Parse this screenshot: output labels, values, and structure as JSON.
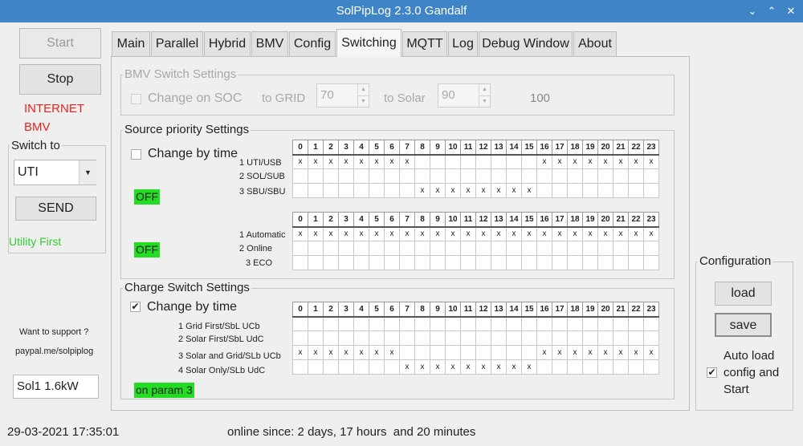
{
  "window": {
    "title": "SolPipLog 2.3.0 Gandalf",
    "minimize_glyph": "⌄",
    "maximize_glyph": "⌃",
    "close_glyph": "✕"
  },
  "left": {
    "start_label": "Start",
    "stop_label": "Stop",
    "status_internet": "INTERNET",
    "status_bmv": "BMV",
    "switch_to_legend": "Switch to",
    "switch_value": "UTI",
    "dropdown_glyph": "▼",
    "send_label": "SEND",
    "mode_text": "Utility First",
    "support_text": "Want to support ?",
    "paypal_text": "paypal.me/solpiplog",
    "device_field": "Sol1 1.6kW"
  },
  "tabs": [
    "Main",
    "Parallel",
    "Hybrid",
    "BMV",
    "Config",
    "Switching",
    "MQTT",
    "Log",
    "Debug Window",
    "About"
  ],
  "active_tab": "Switching",
  "bmv": {
    "legend": "BMV Switch Settings",
    "change_on_soc": "Change on SOC",
    "to_grid_label": "to GRID",
    "to_grid_value": "70",
    "to_solar_label": "to Solar",
    "to_solar_value": "90",
    "soc_value": "100",
    "up_glyph": "▲",
    "down_glyph": "▼"
  },
  "source": {
    "legend": "Source priority Settings",
    "change_by_time": "Change by time",
    "off1": "OFF",
    "off2": "OFF",
    "grid1_rows": [
      "1 UTI/USB",
      "2 SOL/SUB",
      "3 SBU/SBU"
    ],
    "grid1_marks": [
      "XXXXXXXX........XXXXXXXX",
      "........................",
      "........XXXXXXXX........"
    ],
    "grid2_rows": [
      "1 Automatic",
      "2 Online",
      "3 ECO"
    ],
    "grid2_marks": [
      "XXXXXXXXXXXXXXXXXXXXXXXX",
      "........................",
      "........................"
    ]
  },
  "charge": {
    "legend": "Charge Switch Settings",
    "change_by_time": "Change by time",
    "check_glyph": "✔",
    "on_param": "on param 3",
    "rows": [
      "1 Grid First/SbL UCb",
      "2 Solar First/SbL UdC",
      "3 Solar and Grid/SLb UCb",
      "4 Solar Only/SLb UdC"
    ],
    "marks": [
      "........................",
      "........................",
      "XXXXXXX.........XXXXXXXX",
      ".......XXXXXXXXX........"
    ]
  },
  "hours": [
    "0",
    "1",
    "2",
    "3",
    "4",
    "5",
    "6",
    "7",
    "8",
    "9",
    "10",
    "11",
    "12",
    "13",
    "14",
    "15",
    "16",
    "17",
    "18",
    "19",
    "20",
    "21",
    "22",
    "23"
  ],
  "configuration": {
    "legend": "Configuration",
    "load_label": "load",
    "save_label": "save",
    "auto_load": "Auto load config and Start"
  },
  "statusbar": {
    "datetime": "29-03-2021 17:35:01",
    "online": "online since: 2 days, 17 hours  and 20 minutes"
  },
  "colors": {
    "titlebar": "#3e84c6",
    "status_red": "#e8231e",
    "mode_green": "#33cc33",
    "highlight_green": "#22dd22"
  }
}
